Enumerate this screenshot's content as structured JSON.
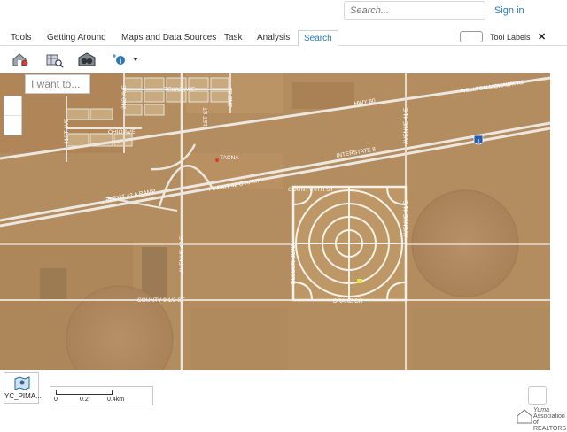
{
  "header": {
    "search_placeholder": "Search...",
    "signin_label": "Sign in"
  },
  "tabs": [
    {
      "label": "Tools"
    },
    {
      "label": "Getting Around"
    },
    {
      "label": "Maps and Data Sources"
    },
    {
      "label": "Task"
    },
    {
      "label": "Analysis"
    },
    {
      "label": "Search"
    }
  ],
  "active_tab": "Search",
  "tool_labels": {
    "label": "Tool Labels",
    "close": "✕"
  },
  "toolbar_icons": [
    "search-house-icon",
    "search-parcel-icon",
    "search-binoculars-icon",
    "identify-info-icon"
  ],
  "map": {
    "iwant_placeholder": "I want to...",
    "labels": {
      "texas_ave": "TEXAS AVE",
      "ohio_ave": "OHIO AVE",
      "hwy80": "HWY 80",
      "wellton": "WELLTON MOHAWK RD",
      "interstate8": "INTERSTATE 8",
      "i8_exit_a": "I-8 EXIT 42 A RAMP",
      "i8_exit_b": "I-8 EXIT 42 C RAMP",
      "county9": "COUNTY 9TH ST",
      "county9half": "COUNTY 9 1/2 ST",
      "nelson": "NELSON BLVD",
      "ave41e": "AVENUE 41 E",
      "ave41e_b": "AVENUE 41 E",
      "ave42e": "AVENUE 42 E",
      "drake": "DRAKE DR",
      "tacna": "TACNA",
      "ave_2nd": "2ND AVE",
      "st_1st": "1ST ST",
      "st_2nd": "2ND ST",
      "ave_41st": "41ST AVE",
      "i8_shield": "8"
    }
  },
  "bottom": {
    "layer_label": "YC_PIMA...",
    "scale_ticks": [
      "0",
      "0.2",
      "0.4km"
    ],
    "logo_line1": "Yuma",
    "logo_line2": "Association",
    "logo_line3": "of REALTORS"
  },
  "colors": {
    "accent": "#2a7ab8",
    "road": "#f2efe8",
    "ground": "#b08b5e"
  }
}
